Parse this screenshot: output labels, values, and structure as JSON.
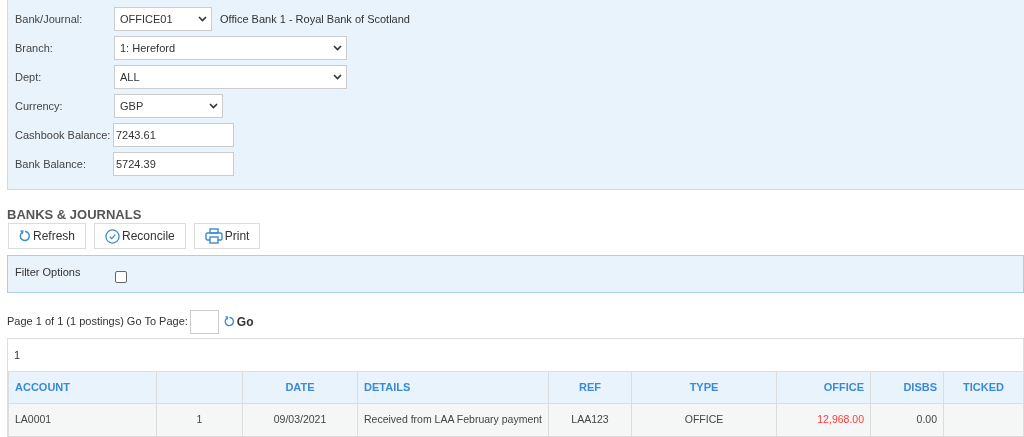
{
  "form": {
    "fields": [
      {
        "label": "Bank/Journal:",
        "kind": "select",
        "value": "OFFICE01",
        "note": "Office Bank 1 - Royal Bank of Scotland"
      },
      {
        "label": "Branch:",
        "kind": "select",
        "value": "1: Hereford"
      },
      {
        "label": "Dept:",
        "kind": "select",
        "value": "ALL"
      },
      {
        "label": "Currency:",
        "kind": "select",
        "value": "GBP"
      },
      {
        "label": "Cashbook Balance:",
        "kind": "text",
        "value": "7243.61"
      },
      {
        "label": "Bank Balance:",
        "kind": "text",
        "value": "5724.39"
      }
    ]
  },
  "section_title": "BANKS & JOURNALS",
  "toolbar": [
    {
      "label": "Refresh"
    },
    {
      "label": "Reconcile"
    },
    {
      "label": "Print"
    }
  ],
  "filter": {
    "label": "Filter Options",
    "checked": false
  },
  "pager": {
    "text": "Page 1 of 1 (1 postings) Go To Page:",
    "go": "Go"
  },
  "page_links": [
    "1"
  ],
  "table": {
    "columns": [
      "ACCOUNT",
      "",
      "DATE",
      "DETAILS",
      "REF",
      "TYPE",
      "OFFICE",
      "DISBS",
      "TICKED"
    ],
    "rows": [
      {
        "cells": [
          {
            "text": "LA0001"
          },
          {
            "text": "1"
          },
          {
            "text": "09/03/2021"
          },
          {
            "text": "Received from LAA February payment"
          },
          {
            "text": "LAA123"
          },
          {
            "text": "OFFICE"
          },
          {
            "text": "12,968.00",
            "alert": true
          },
          {
            "text": "0.00"
          },
          {
            "text": ""
          }
        ]
      }
    ]
  }
}
